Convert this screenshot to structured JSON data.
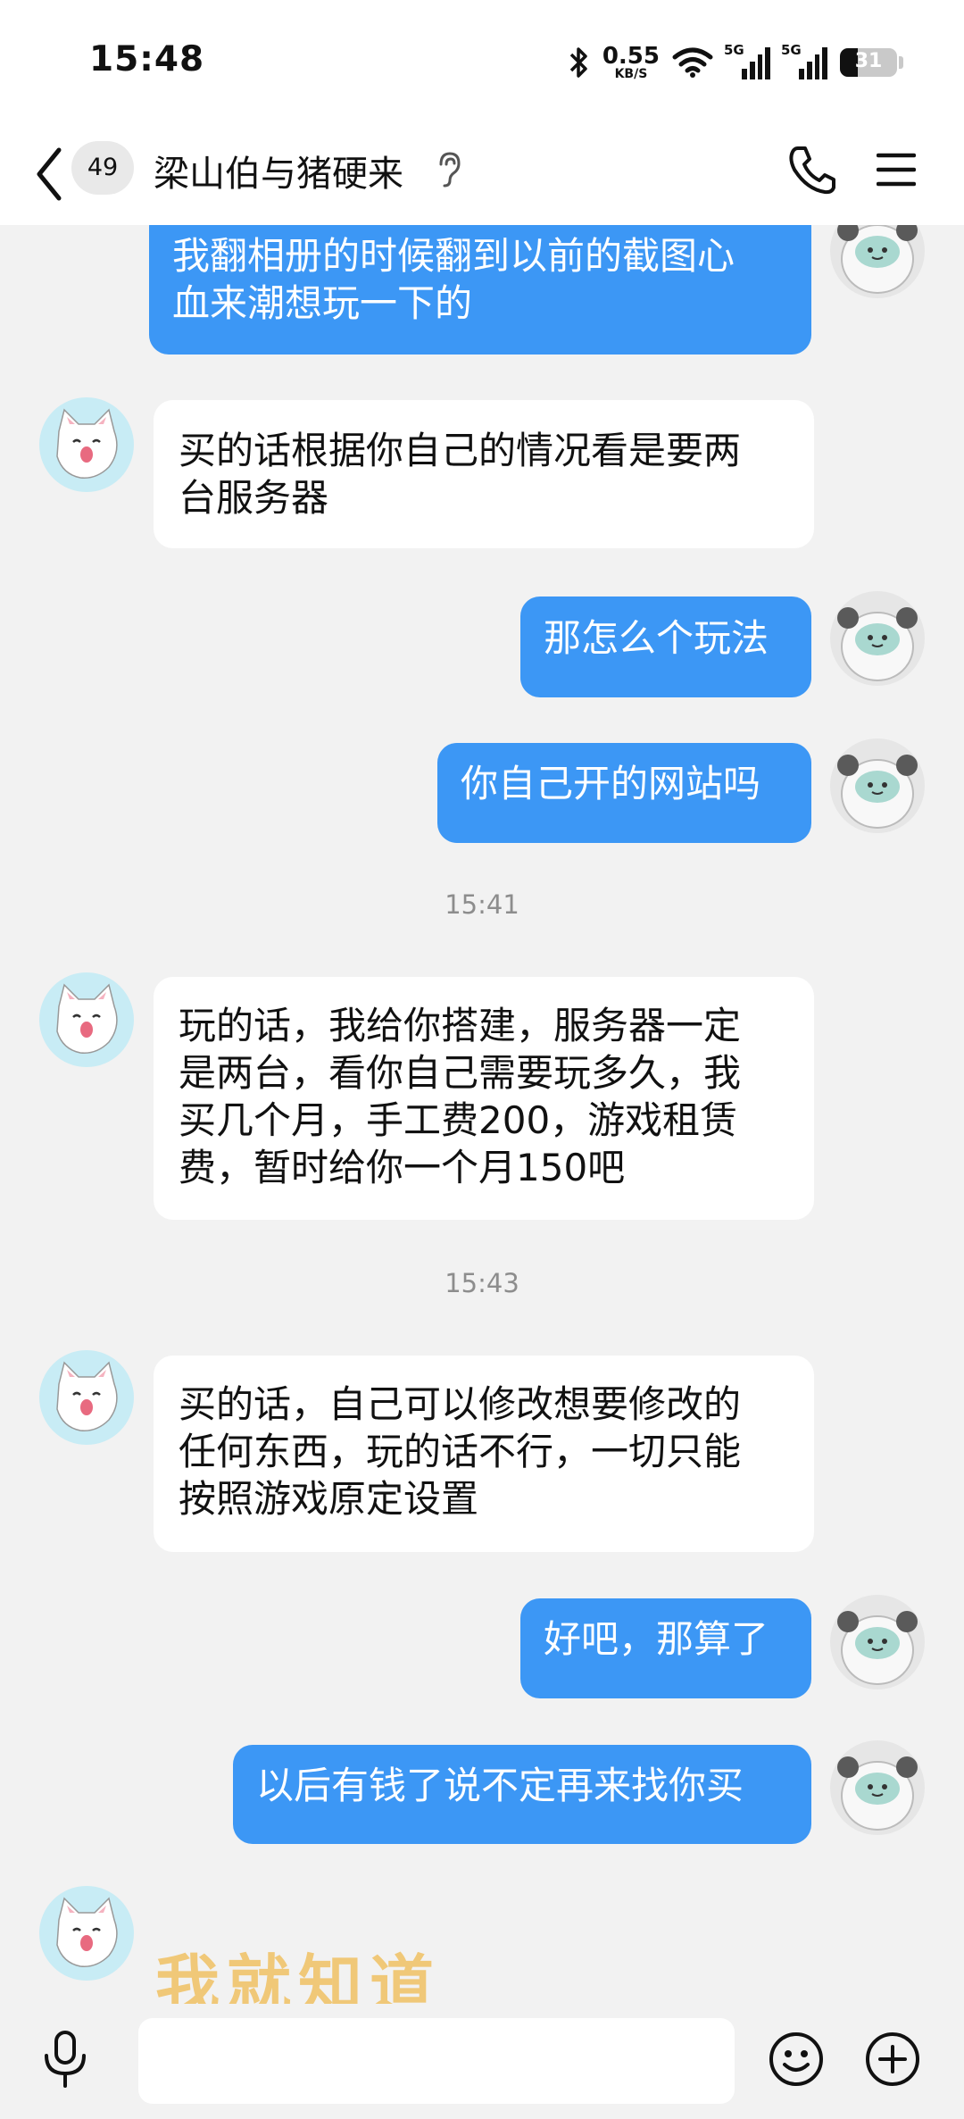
{
  "status": {
    "time": "15:48",
    "net_speed_value": "0.55",
    "net_speed_unit": "KB/S",
    "signal1_label": "5G",
    "signal2_label": "5G",
    "battery_level": "31",
    "battery_fraction": 0.31,
    "icons": [
      "bluetooth-icon",
      "wifi-icon",
      "signal-icon",
      "battery-icon"
    ]
  },
  "header": {
    "unread_count": "49",
    "title": "梁山伯与猪硬来",
    "icons": [
      "back-icon",
      "ear-icon",
      "phone-icon",
      "menu-icon"
    ]
  },
  "messages": [
    {
      "side": "out",
      "lines": [
        "我翻相册的时候翻到以前的截图心",
        "血来潮想玩一下的"
      ]
    },
    {
      "side": "in",
      "lines": [
        "买的话根据你自己的情况看是要两",
        "台服务器"
      ]
    },
    {
      "side": "out",
      "lines": [
        "那怎么个玩法"
      ]
    },
    {
      "side": "out",
      "lines": [
        "你自己开的网站吗"
      ]
    },
    {
      "timestamp": "15:41"
    },
    {
      "side": "in",
      "lines": [
        "玩的话，我给你搭建，服务器一定",
        "是两台，看你自己需要玩多久，我",
        "买几个月，手工费200，游戏租赁",
        "费，暂时给你一个月150吧"
      ]
    },
    {
      "timestamp": "15:43"
    },
    {
      "side": "in",
      "lines": [
        "买的话，自己可以修改想要修改的",
        "任何东西，玩的话不行，一切只能",
        "按照游戏原定设置"
      ]
    },
    {
      "side": "out",
      "lines": [
        "好吧，那算了"
      ]
    },
    {
      "side": "out",
      "lines": [
        "以后有钱了说不定再来找你买"
      ]
    },
    {
      "side": "in",
      "sticker_text": "我就知道"
    }
  ],
  "input": {
    "value": "",
    "placeholder": "",
    "icons": [
      "mic-icon",
      "emoji-icon",
      "plus-icon"
    ]
  },
  "colors": {
    "outgoing_bubble": "#3c97f5",
    "incoming_bubble": "#ffffff",
    "chat_background": "#f2f2f2",
    "sticker": "#f0c878"
  }
}
